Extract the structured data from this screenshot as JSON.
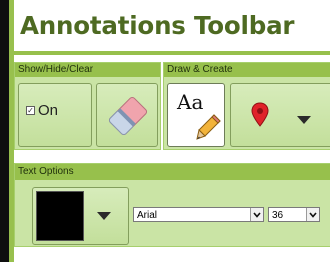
{
  "toolbar": {
    "title": "Annotations Toolbar"
  },
  "show_hide_clear": {
    "header": "Show/Hide/Clear",
    "toggle_label": "On",
    "toggle_checked": true
  },
  "draw_create": {
    "header": "Draw & Create",
    "text_tool_label": "Aa"
  },
  "text_options": {
    "header": "Text Options",
    "color": "#000000",
    "font_family": "Arial",
    "font_size": "36"
  },
  "colors": {
    "accent": "#98c04e",
    "panel": "#cae4a5",
    "title": "#4e6a22",
    "marker": "#e0222a"
  }
}
